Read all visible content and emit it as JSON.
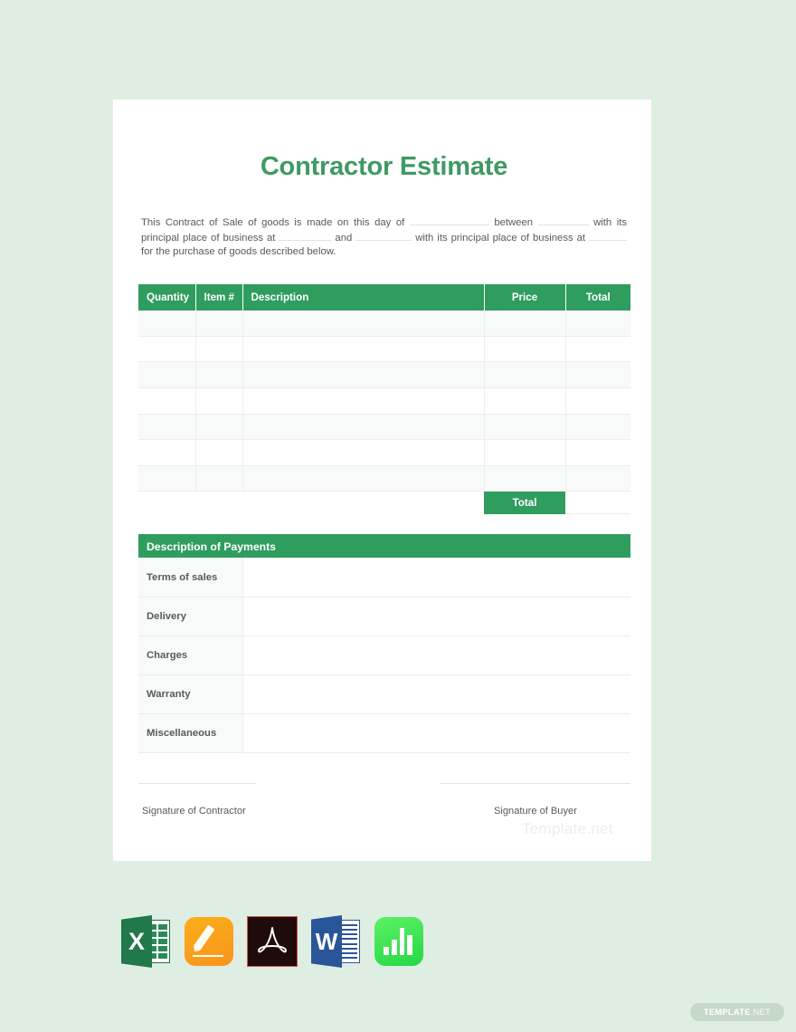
{
  "page": {
    "background_color": "#dfeee3",
    "accent_color": "#2f9d5e",
    "title_color": "#3f9a63"
  },
  "document": {
    "title": "Contractor Estimate",
    "intro": {
      "part1": "This Contract of Sale of goods is made on this day of",
      "part2": "between",
      "part3": "with its principal place of business at",
      "part4": "and",
      "part5": "with its principal place of business at",
      "part6": "for the purchase of goods described below."
    },
    "items_table": {
      "columns": [
        "Quantity",
        "Item #",
        "Description",
        "Price",
        "Total"
      ],
      "rows": [
        [
          "",
          "",
          "",
          "",
          ""
        ],
        [
          "",
          "",
          "",
          "",
          ""
        ],
        [
          "",
          "",
          "",
          "",
          ""
        ],
        [
          "",
          "",
          "",
          "",
          ""
        ],
        [
          "",
          "",
          "",
          "",
          ""
        ],
        [
          "",
          "",
          "",
          "",
          ""
        ],
        [
          "",
          "",
          "",
          "",
          ""
        ]
      ],
      "total_label": "Total",
      "total_value": ""
    },
    "payments": {
      "header": "Description of Payments",
      "rows": [
        {
          "label": "Terms of sales",
          "value": ""
        },
        {
          "label": "Delivery",
          "value": ""
        },
        {
          "label": "Charges",
          "value": ""
        },
        {
          "label": "Warranty",
          "value": ""
        },
        {
          "label": "Miscellaneous",
          "value": ""
        }
      ]
    },
    "signatures": {
      "contractor": "Signature of Contractor",
      "buyer": "Signature of Buyer"
    },
    "watermark": "Template.net"
  },
  "formats": [
    {
      "name": "excel",
      "letter": "X"
    },
    {
      "name": "pages",
      "letter": ""
    },
    {
      "name": "pdf",
      "letter": ""
    },
    {
      "name": "word",
      "letter": "W"
    },
    {
      "name": "numbers",
      "letter": ""
    }
  ],
  "badge": {
    "main": "TEMPLATE",
    "sub": ".NET"
  }
}
